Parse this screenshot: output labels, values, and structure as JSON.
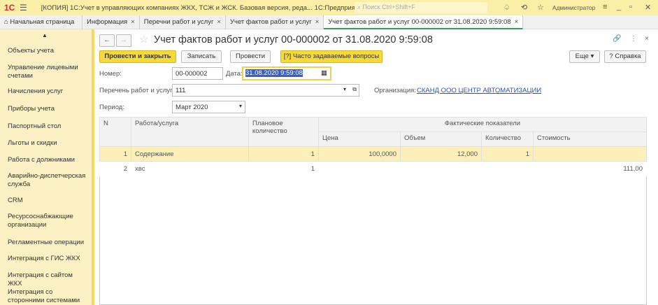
{
  "topbar": {
    "logo": "1С",
    "title": "[КОПИЯ] 1С:Учет в управляющих компаниях ЖКХ, ТСЖ и ЖСК. Базовая версия, реда...  1С:Предприятие",
    "search_placeholder": "Поиск Ctrl+Shift+F",
    "user": "Администратор"
  },
  "tabs": [
    {
      "label": "Начальная страница"
    },
    {
      "label": "Информация"
    },
    {
      "label": "Перечни работ и услуг"
    },
    {
      "label": "Учет фактов работ и услуг"
    },
    {
      "label": "Учет фактов работ и услуг 00-000002 от 31.08.2020 9:59:08"
    }
  ],
  "sidebar": {
    "items": [
      "Объекты учета",
      "Управление лицевыми счетами",
      "Начисления услуг",
      "Приборы учета",
      "Паспортный стол",
      "Льготы и скидки",
      "Работа с должниками",
      "Аварийно-диспетчерская служба",
      "CRM",
      "Ресурсоснабжающие организации",
      "Регламентные операции",
      "Интеграция с ГИС ЖКХ",
      "Интеграция с сайтом ЖКХ",
      "Интеграция со сторонними системами"
    ]
  },
  "doc": {
    "title": "Учет фактов работ и услуг 00-000002 от 31.08.2020 9:59:08",
    "buttons": {
      "post_close": "Провести и закрыть",
      "save": "Записать",
      "post": "Провести",
      "faq": "Часто задаваемые вопросы",
      "more": "Еще",
      "help": "Справка"
    },
    "number_label": "Номер:",
    "number": "00-000002",
    "date_label": "Дата:",
    "date": "31.08.2020  9:59:08",
    "list_label": "Перечень работ и услуг:",
    "list": "111",
    "org_label": "Организация:",
    "org": "СКАНД ООО ЦЕНТР АВТОМАТИЗАЦИИ",
    "period_label": "Период:",
    "period": "Март 2020"
  },
  "table": {
    "headers": {
      "n": "N",
      "work": "Работа/услуга",
      "plan": "Плановое количество",
      "actual": "Фактические показатели",
      "price": "Цена",
      "volume": "Объем",
      "qty": "Количество",
      "cost": "Стоимость"
    },
    "rows": [
      {
        "n": "1",
        "work": "Содержание",
        "plan": "1",
        "price": "100,0000",
        "volume": "12,000",
        "qty": "1",
        "cost": ""
      },
      {
        "n": "2",
        "work": "хвс",
        "plan": "1",
        "price": "",
        "volume": "",
        "qty": "",
        "cost": "111,00"
      }
    ]
  }
}
